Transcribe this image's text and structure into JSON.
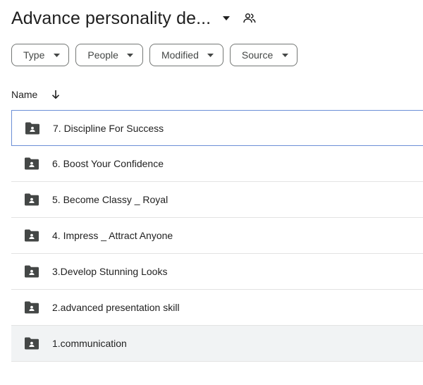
{
  "header": {
    "title": "Advance personality de...",
    "caret_icon": "arrow-drop-down-icon",
    "shared_icon": "shared-people-icon"
  },
  "filters": [
    {
      "label": "Type"
    },
    {
      "label": "People"
    },
    {
      "label": "Modified"
    },
    {
      "label": "Source"
    }
  ],
  "columns": {
    "name_label": "Name",
    "sort_icon": "arrow-down-icon"
  },
  "rows": [
    {
      "label": "7. Discipline For Success",
      "icon": "shared-folder-icon"
    },
    {
      "label": "6. Boost Your Confidence",
      "icon": "shared-folder-icon"
    },
    {
      "label": "5. Become Classy _ Royal",
      "icon": "shared-folder-icon"
    },
    {
      "label": "4. Impress _ Attract Anyone",
      "icon": "shared-folder-icon"
    },
    {
      "label": "3.Develop Stunning Looks",
      "icon": "shared-folder-icon"
    },
    {
      "label": "2.advanced presentation skill",
      "icon": "shared-folder-icon"
    },
    {
      "label": "1.communication",
      "icon": "shared-folder-icon"
    }
  ],
  "colors": {
    "text": "#1f1f1f",
    "chip_border": "#747775",
    "row_divider": "#e3e3e3",
    "focus_outline": "#6b8fd6",
    "hover_bg": "#f1f3f4",
    "folder_icon": "#444746"
  }
}
